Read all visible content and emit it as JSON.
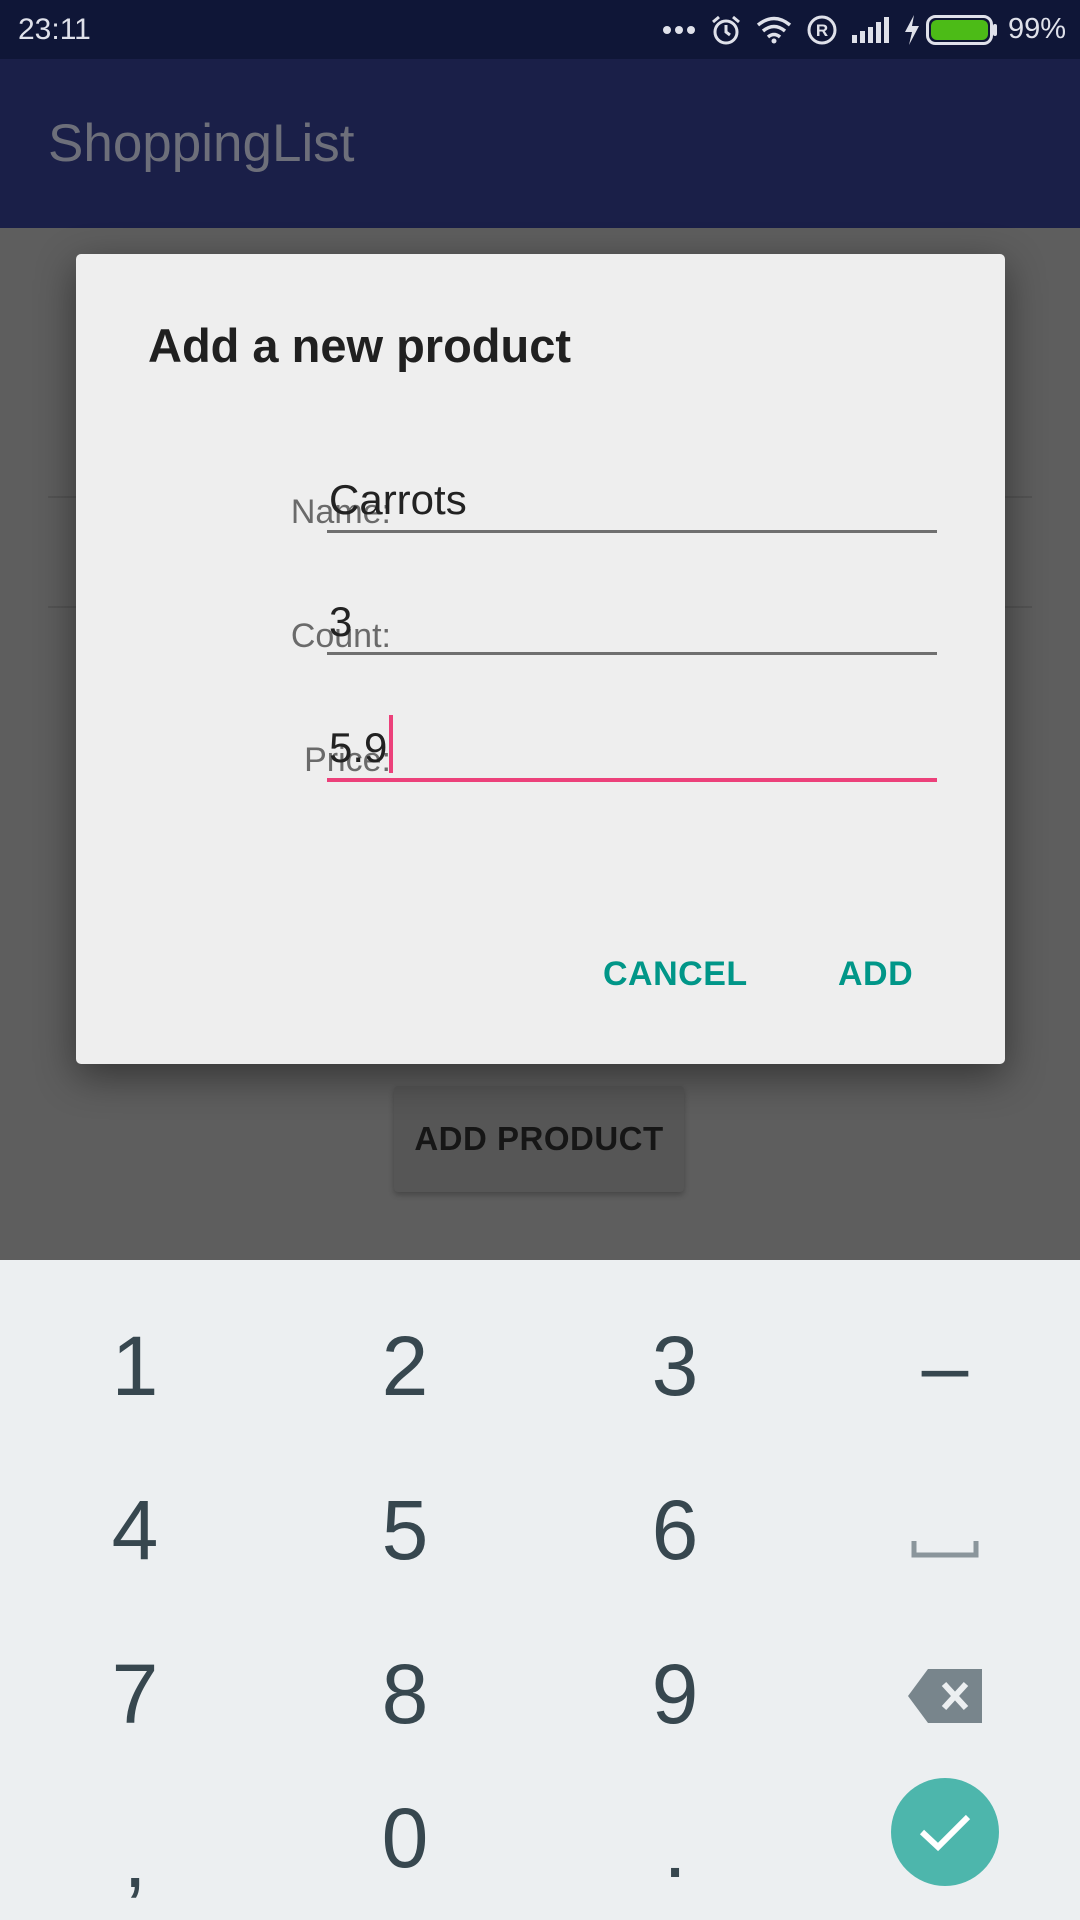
{
  "status_bar": {
    "time": "23:11",
    "battery_percent": "99%",
    "icons": [
      "more-dots-icon",
      "alarm-icon",
      "wifi-icon",
      "registered-icon",
      "signal-icon",
      "charging-icon",
      "battery-icon"
    ],
    "battery_color": "#4cbb17"
  },
  "app_bar": {
    "title": "ShoppingList"
  },
  "background": {
    "add_product_label": "ADD PRODUCT"
  },
  "dialog": {
    "title": "Add a new product",
    "fields": [
      {
        "label": "Name:",
        "value": "Carrots"
      },
      {
        "label": "Count:",
        "value": "3"
      },
      {
        "label": "Price:",
        "value": "5.9"
      }
    ],
    "cancel_label": "CANCEL",
    "add_label": "ADD",
    "accent_color": "#009688",
    "focus_color": "#ec407a"
  },
  "keyboard": {
    "keys": [
      [
        "1",
        "2",
        "3",
        "–"
      ],
      [
        "4",
        "5",
        "6",
        "space-icon"
      ],
      [
        "7",
        "8",
        "9",
        "backspace-icon"
      ],
      [
        ",",
        "0",
        ".",
        "enter-check-icon"
      ]
    ],
    "enter_color": "#4db6ac"
  }
}
